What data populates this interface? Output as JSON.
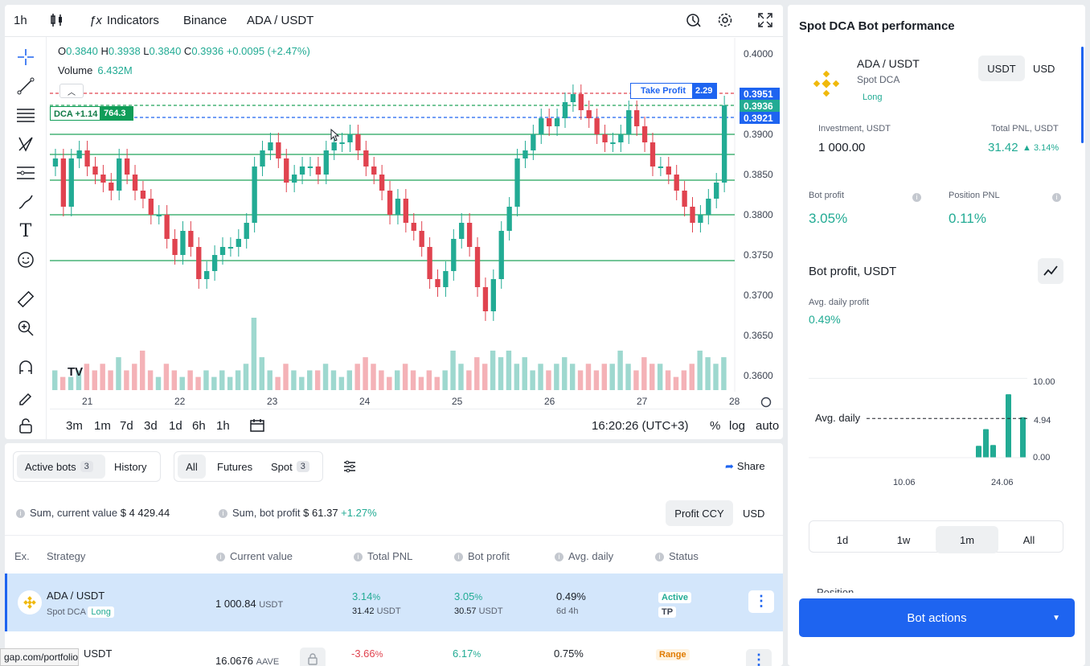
{
  "chart": {
    "timeframe": "1h",
    "indicators_label": "Indicators",
    "exchange": "Binance",
    "symbol": "ADA / USDT",
    "ohlc": {
      "o_label": "O",
      "o": "0.3840",
      "h_label": "H",
      "h": "0.3938",
      "l_label": "L",
      "l": "0.3840",
      "c_label": "C",
      "c": "0.3936",
      "change": "+0.0095 (+2.47%)"
    },
    "volume_label": "Volume",
    "volume_value": "6.432M",
    "take_profit_label": "Take Profit",
    "take_profit_value": "2.29",
    "dca_label": "DCA +1.14",
    "dca_value": "764.3",
    "price_tags": [
      "0.3951",
      "0.3936",
      "0.3921"
    ],
    "price_ticks": [
      "0.4000",
      "0.3900",
      "0.3850",
      "0.3800",
      "0.3750",
      "0.3700",
      "0.3650",
      "0.3600"
    ],
    "date_ticks": [
      "21",
      "22",
      "23",
      "24",
      "25",
      "26",
      "27",
      "28"
    ],
    "ranges": [
      "3m",
      "1m",
      "7d",
      "3d",
      "1d",
      "6h",
      "1h"
    ],
    "clock": "16:20:26 (UTC+3)",
    "percent_label": "%",
    "log_label": "log",
    "auto_label": "auto",
    "brand_logo": "TV"
  },
  "chart_data": {
    "type": "candlestick",
    "title": "",
    "ylim": [
      0.358,
      0.402
    ],
    "series": [
      {
        "name": "ADA / USDT",
        "values": [
          0.387,
          0.381,
          0.387,
          0.388,
          0.386,
          0.385,
          0.384,
          0.383,
          0.387,
          0.385,
          0.383,
          0.382,
          0.38,
          0.38,
          0.377,
          0.375,
          0.378,
          0.376,
          0.372,
          0.373,
          0.375,
          0.376,
          0.376,
          0.377,
          0.379,
          0.386,
          0.388,
          0.389,
          0.387,
          0.384,
          0.385,
          0.386,
          0.386,
          0.385,
          0.388,
          0.389,
          0.389,
          0.39,
          0.388,
          0.386,
          0.385,
          0.383,
          0.38,
          0.382,
          0.379,
          0.378,
          0.376,
          0.372,
          0.371,
          0.373,
          0.377,
          0.379,
          0.376,
          0.371,
          0.368,
          0.372,
          0.378,
          0.381,
          0.387,
          0.388,
          0.39,
          0.392,
          0.391,
          0.392,
          0.394,
          0.395,
          0.393,
          0.392,
          0.39,
          0.389,
          0.389,
          0.39,
          0.393,
          0.391,
          0.389,
          0.386,
          0.386,
          0.385,
          0.383,
          0.381,
          0.379,
          0.38,
          0.382,
          0.384,
          0.3936
        ]
      }
    ],
    "volume": [
      3,
      2,
      2,
      3,
      4,
      3,
      4,
      3,
      5,
      3,
      4,
      6,
      3,
      2,
      4,
      3,
      2,
      3,
      2,
      3,
      2,
      3,
      2,
      3,
      4,
      11,
      5,
      3,
      2,
      4,
      3,
      2,
      3,
      3,
      4,
      3,
      2,
      3,
      4,
      5,
      4,
      3,
      2,
      3,
      4,
      3,
      2,
      3,
      2,
      3,
      6,
      4,
      3,
      5,
      4,
      6,
      5,
      6,
      4,
      5,
      3,
      4,
      3,
      4,
      5,
      4,
      3,
      4,
      3,
      4,
      4,
      6,
      4,
      3,
      5,
      4,
      4,
      3,
      2,
      3,
      4,
      6,
      5,
      4,
      5
    ],
    "levels": [
      0.3951,
      0.3936,
      0.3921,
      0.39,
      0.3875,
      0.3843,
      0.38,
      0.3743
    ]
  },
  "bots": {
    "tabs": {
      "active_label": "Active bots",
      "active_count": "3",
      "history_label": "History"
    },
    "filters": {
      "all": "All",
      "futures": "Futures",
      "spot": "Spot",
      "spot_count": "3"
    },
    "share_label": "Share",
    "sum_current_label": "Sum, current value",
    "sum_current_value": "$ 4 429.44",
    "sum_profit_label": "Sum, bot profit",
    "sum_profit_value": "$ 61.37",
    "sum_profit_pct": "+1.27%",
    "ccy_profit": "Profit CCY",
    "ccy_usd": "USD",
    "columns": {
      "ex": "Ex.",
      "strategy": "Strategy",
      "current": "Current value",
      "pnl": "Total PNL",
      "profit": "Bot profit",
      "daily": "Avg. daily",
      "status": "Status"
    },
    "rows": [
      {
        "pair": "ADA / USDT",
        "type": "Spot DCA",
        "tag": "Long",
        "current": "1 000.84",
        "current_unit": "USDT",
        "pnl_pct": "3.14",
        "pnl_unit": "%",
        "pnl_abs": "31.42",
        "pnl_abs_unit": "USDT",
        "profit_pct": "3.05",
        "profit_unit": "%",
        "profit_abs": "30.57",
        "profit_abs_unit": "USDT",
        "daily": "0.49%",
        "age": "6d 4h",
        "status": "Active",
        "status2": "TP"
      },
      {
        "pair": "USDT",
        "current": "16.0676",
        "current_unit": "AAVE",
        "pnl_pct": "-3.66",
        "pnl_unit": "%",
        "profit_pct": "6.17",
        "profit_unit": "%",
        "daily": "0.75%",
        "status": "Range"
      }
    ]
  },
  "url_tooltip": "gap.com/portfolio",
  "perf": {
    "title": "Spot DCA Bot performance",
    "pair": "ADA / USDT",
    "bot_type": "Spot DCA",
    "direction": "Long",
    "ccy_usdt": "USDT",
    "ccy_usd": "USD",
    "investment_label": "Investment, USDT",
    "investment_value": "1 000.00",
    "total_pnl_label": "Total PNL, USDT",
    "total_pnl_value": "31.42",
    "total_pnl_pct": "▲ 3.14%",
    "bot_profit_label": "Bot profit",
    "bot_profit_value": "3.05%",
    "position_pnl_label": "Position PNL",
    "position_pnl_value": "0.11%",
    "profit_chart_title": "Bot profit, USDT",
    "avg_daily_label": "Avg. daily profit",
    "avg_daily_value": "0.49%",
    "avg_line_label": "Avg. daily",
    "y_ticks": [
      "10.00",
      "4.94",
      "0.00"
    ],
    "x_ticks": [
      "10.06",
      "24.06"
    ],
    "periods": [
      "1d",
      "1w",
      "1m",
      "All"
    ],
    "partial_label": "Position",
    "bot_actions": "Bot actions"
  },
  "bot_profit_chart": {
    "type": "bar",
    "ylim": [
      0,
      14
    ],
    "avg": 4.94,
    "values": [
      1.5,
      3.6,
      1.6,
      8.0,
      5.1
    ]
  },
  "colors": {
    "up": "#22ab94",
    "down": "#e0434f",
    "accent": "#0d6efd",
    "active_row": "#d3e6fb"
  }
}
